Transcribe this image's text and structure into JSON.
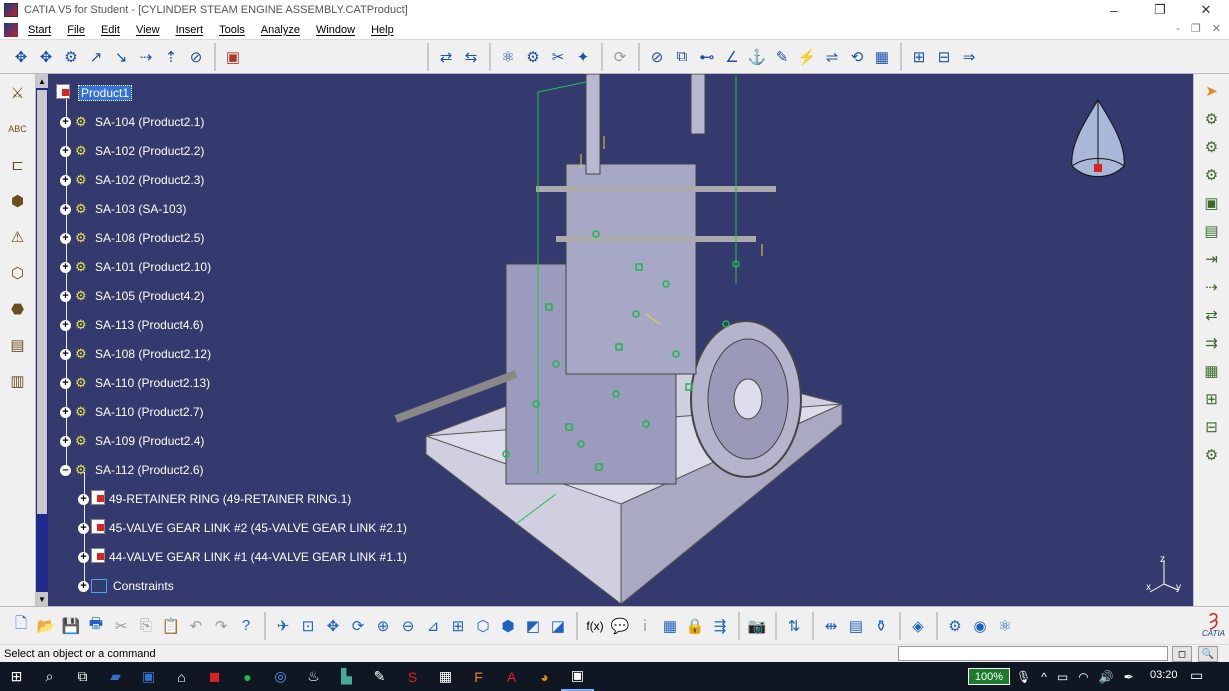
{
  "window": {
    "title": "CATIA V5 for Student - [CYLINDER STEAM ENGINE ASSEMBLY.CATProduct]",
    "controls": [
      "–",
      "❐",
      "✕"
    ]
  },
  "menu": {
    "items": [
      "Start",
      "File",
      "Edit",
      "View",
      "Insert",
      "Tools",
      "Analyze",
      "Window",
      "Help"
    ],
    "mdi_controls": "- ❐ ✕"
  },
  "tree": {
    "root": "Product1",
    "items": [
      {
        "label": "SA-104 (Product2.1)",
        "expander": "+"
      },
      {
        "label": "SA-102 (Product2.2)",
        "expander": "+"
      },
      {
        "label": "SA-102 (Product2.3)",
        "expander": "+"
      },
      {
        "label": "SA-103 (SA-103)",
        "expander": "+"
      },
      {
        "label": "SA-108 (Product2.5)",
        "expander": "+"
      },
      {
        "label": "SA-101 (Product2.10)",
        "expander": "+"
      },
      {
        "label": "SA-105 (Product4.2)",
        "expander": "+"
      },
      {
        "label": "SA-113 (Product4.6)",
        "expander": "+"
      },
      {
        "label": "SA-108 (Product2.12)",
        "expander": "+"
      },
      {
        "label": "SA-110 (Product2.13)",
        "expander": "+"
      },
      {
        "label": "SA-110 (Product2.7)",
        "expander": "+"
      },
      {
        "label": "SA-109 (Product2.4)",
        "expander": "+"
      },
      {
        "label": "SA-112 (Product2.6)",
        "expander": "–"
      }
    ],
    "children": [
      {
        "label": "49-RETAINER RING (49-RETAINER RING.1)"
      },
      {
        "label": "45-VALVE GEAR LINK #2 (45-VALVE GEAR LINK #2.1)"
      },
      {
        "label": "44-VALVE GEAR LINK #1 (44-VALVE GEAR LINK #1.1)"
      },
      {
        "label": "Constraints"
      }
    ]
  },
  "axes": {
    "x": "x",
    "y": "y",
    "z": "z"
  },
  "status": {
    "message": "Select an object or a command"
  },
  "taskbar": {
    "zoom": "100%",
    "time": "03:20"
  },
  "colors": {
    "viewport_bg": "#343a6e",
    "tree_selection": "#3472d8",
    "constraint_green": "#1fb64a",
    "taskbar": "#101722"
  },
  "brand": "CATIA"
}
